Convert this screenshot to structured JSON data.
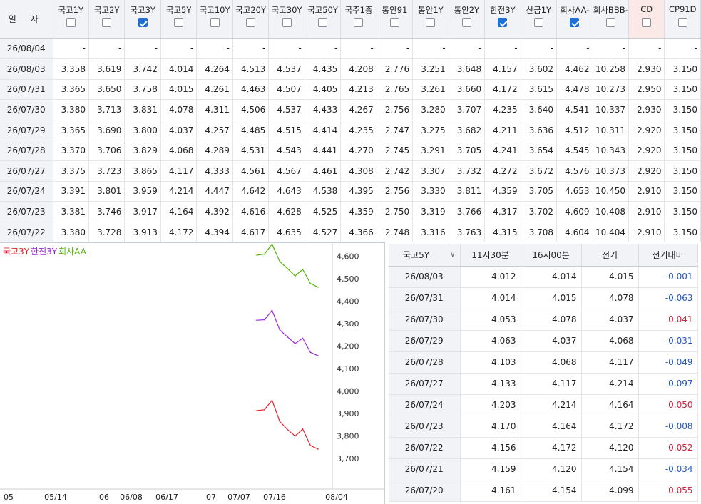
{
  "rate_table": {
    "date_header": "일 자",
    "columns": [
      {
        "label": "국고1Y",
        "checked": false
      },
      {
        "label": "국고2Y",
        "checked": false
      },
      {
        "label": "국고3Y",
        "checked": true
      },
      {
        "label": "국고5Y",
        "checked": false
      },
      {
        "label": "국고10Y",
        "checked": false
      },
      {
        "label": "국고20Y",
        "checked": false
      },
      {
        "label": "국고30Y",
        "checked": false
      },
      {
        "label": "국고50Y",
        "checked": false
      },
      {
        "label": "국주1종",
        "checked": false
      },
      {
        "label": "통안91",
        "checked": false
      },
      {
        "label": "통안1Y",
        "checked": false
      },
      {
        "label": "통안2Y",
        "checked": false
      },
      {
        "label": "한전3Y",
        "checked": true
      },
      {
        "label": "산금1Y",
        "checked": false
      },
      {
        "label": "회사AA-",
        "checked": true
      },
      {
        "label": "회사BBB-",
        "checked": false
      },
      {
        "label": "CD",
        "checked": false
      },
      {
        "label": "CP91D",
        "checked": false
      }
    ],
    "rows": [
      {
        "date": "26/08/04",
        "values": [
          "-",
          "-",
          "-",
          "-",
          "-",
          "-",
          "-",
          "-",
          "-",
          "-",
          "-",
          "-",
          "-",
          "-",
          "-",
          "-",
          "-",
          "-"
        ]
      },
      {
        "date": "26/08/03",
        "values": [
          "3.358",
          "3.619",
          "3.742",
          "4.014",
          "4.264",
          "4.513",
          "4.537",
          "4.435",
          "4.208",
          "2.776",
          "3.251",
          "3.648",
          "4.157",
          "3.602",
          "4.462",
          "10.258",
          "2.930",
          "3.150"
        ]
      },
      {
        "date": "26/07/31",
        "values": [
          "3.365",
          "3.650",
          "3.758",
          "4.015",
          "4.261",
          "4.463",
          "4.507",
          "4.405",
          "4.213",
          "2.765",
          "3.261",
          "3.660",
          "4.172",
          "3.615",
          "4.478",
          "10.273",
          "2.950",
          "3.150"
        ]
      },
      {
        "date": "26/07/30",
        "values": [
          "3.380",
          "3.713",
          "3.831",
          "4.078",
          "4.311",
          "4.506",
          "4.537",
          "4.433",
          "4.267",
          "2.756",
          "3.280",
          "3.707",
          "4.235",
          "3.640",
          "4.541",
          "10.337",
          "2.930",
          "3.150"
        ]
      },
      {
        "date": "26/07/29",
        "values": [
          "3.365",
          "3.690",
          "3.800",
          "4.037",
          "4.257",
          "4.485",
          "4.515",
          "4.414",
          "4.235",
          "2.747",
          "3.275",
          "3.682",
          "4.211",
          "3.636",
          "4.512",
          "10.311",
          "2.920",
          "3.150"
        ]
      },
      {
        "date": "26/07/28",
        "values": [
          "3.370",
          "3.706",
          "3.829",
          "4.068",
          "4.289",
          "4.531",
          "4.543",
          "4.441",
          "4.270",
          "2.745",
          "3.291",
          "3.705",
          "4.241",
          "3.654",
          "4.545",
          "10.343",
          "2.920",
          "3.150"
        ]
      },
      {
        "date": "26/07/27",
        "values": [
          "3.375",
          "3.723",
          "3.865",
          "4.117",
          "4.333",
          "4.561",
          "4.567",
          "4.461",
          "4.308",
          "2.742",
          "3.307",
          "3.732",
          "4.272",
          "3.672",
          "4.576",
          "10.373",
          "2.920",
          "3.150"
        ]
      },
      {
        "date": "26/07/24",
        "values": [
          "3.391",
          "3.801",
          "3.959",
          "4.214",
          "4.447",
          "4.642",
          "4.643",
          "4.538",
          "4.395",
          "2.756",
          "3.330",
          "3.811",
          "4.359",
          "3.705",
          "4.653",
          "10.450",
          "2.910",
          "3.150"
        ]
      },
      {
        "date": "26/07/23",
        "values": [
          "3.381",
          "3.746",
          "3.917",
          "4.164",
          "4.392",
          "4.616",
          "4.628",
          "4.525",
          "4.359",
          "2.750",
          "3.319",
          "3.766",
          "4.317",
          "3.702",
          "4.609",
          "10.408",
          "2.910",
          "3.150"
        ]
      },
      {
        "date": "26/07/22",
        "values": [
          "3.380",
          "3.728",
          "3.913",
          "4.172",
          "4.394",
          "4.617",
          "4.635",
          "4.527",
          "4.366",
          "2.748",
          "3.316",
          "3.763",
          "4.315",
          "3.708",
          "4.604",
          "10.404",
          "2.910",
          "3.150"
        ]
      }
    ]
  },
  "legend": [
    {
      "name": "국고3Y",
      "color": "#e8202a"
    },
    {
      "name": "한전3Y",
      "color": "#9c27d9"
    },
    {
      "name": "회사AA-",
      "color": "#55b50a"
    }
  ],
  "chart_data": {
    "type": "line",
    "ylim": [
      3.65,
      4.62
    ],
    "y_ticks": [
      "4,600",
      "4,500",
      "4,400",
      "4,300",
      "4,200",
      "4,100",
      "4,000",
      "3,900",
      "3,800",
      "3,700"
    ],
    "x_tick_labels": [
      "05",
      "05/14",
      "06",
      "06/08",
      "06/17",
      "07",
      "07/07",
      "07/16",
      "08/04"
    ],
    "x": [
      "26/07/22",
      "26/07/23",
      "26/07/24",
      "26/07/27",
      "26/07/28",
      "26/07/29",
      "26/07/30",
      "26/07/31",
      "26/08/03"
    ],
    "series": [
      {
        "name": "국고3Y",
        "color": "#e8202a",
        "values": [
          3.913,
          3.917,
          3.959,
          3.865,
          3.829,
          3.8,
          3.831,
          3.758,
          3.742
        ]
      },
      {
        "name": "한전3Y",
        "color": "#9c27d9",
        "values": [
          4.315,
          4.317,
          4.359,
          4.272,
          4.241,
          4.211,
          4.235,
          4.172,
          4.157
        ]
      },
      {
        "name": "회사AA-",
        "color": "#55b50a",
        "values": [
          4.604,
          4.609,
          4.653,
          4.576,
          4.545,
          4.512,
          4.541,
          4.478,
          4.462
        ]
      }
    ]
  },
  "daily_table": {
    "selector_label": "국고5Y",
    "headers": [
      "11시30분",
      "16시00분",
      "전기",
      "전기대비"
    ],
    "rows": [
      {
        "date": "26/08/03",
        "t1130": "4.012",
        "t1600": "4.014",
        "prev": "4.015",
        "change": "-0.001"
      },
      {
        "date": "26/07/31",
        "t1130": "4.014",
        "t1600": "4.015",
        "prev": "4.078",
        "change": "-0.063"
      },
      {
        "date": "26/07/30",
        "t1130": "4.053",
        "t1600": "4.078",
        "prev": "4.037",
        "change": "0.041"
      },
      {
        "date": "26/07/29",
        "t1130": "4.063",
        "t1600": "4.037",
        "prev": "4.068",
        "change": "-0.031"
      },
      {
        "date": "26/07/28",
        "t1130": "4.103",
        "t1600": "4.068",
        "prev": "4.117",
        "change": "-0.049"
      },
      {
        "date": "26/07/27",
        "t1130": "4.133",
        "t1600": "4.117",
        "prev": "4.214",
        "change": "-0.097"
      },
      {
        "date": "26/07/24",
        "t1130": "4.203",
        "t1600": "4.214",
        "prev": "4.164",
        "change": "0.050"
      },
      {
        "date": "26/07/23",
        "t1130": "4.170",
        "t1600": "4.164",
        "prev": "4.172",
        "change": "-0.008"
      },
      {
        "date": "26/07/22",
        "t1130": "4.156",
        "t1600": "4.172",
        "prev": "4.120",
        "change": "0.052"
      },
      {
        "date": "26/07/21",
        "t1130": "4.159",
        "t1600": "4.120",
        "prev": "4.154",
        "change": "-0.034"
      },
      {
        "date": "26/07/20",
        "t1130": "4.161",
        "t1600": "4.154",
        "prev": "4.099",
        "change": "0.055"
      }
    ]
  }
}
